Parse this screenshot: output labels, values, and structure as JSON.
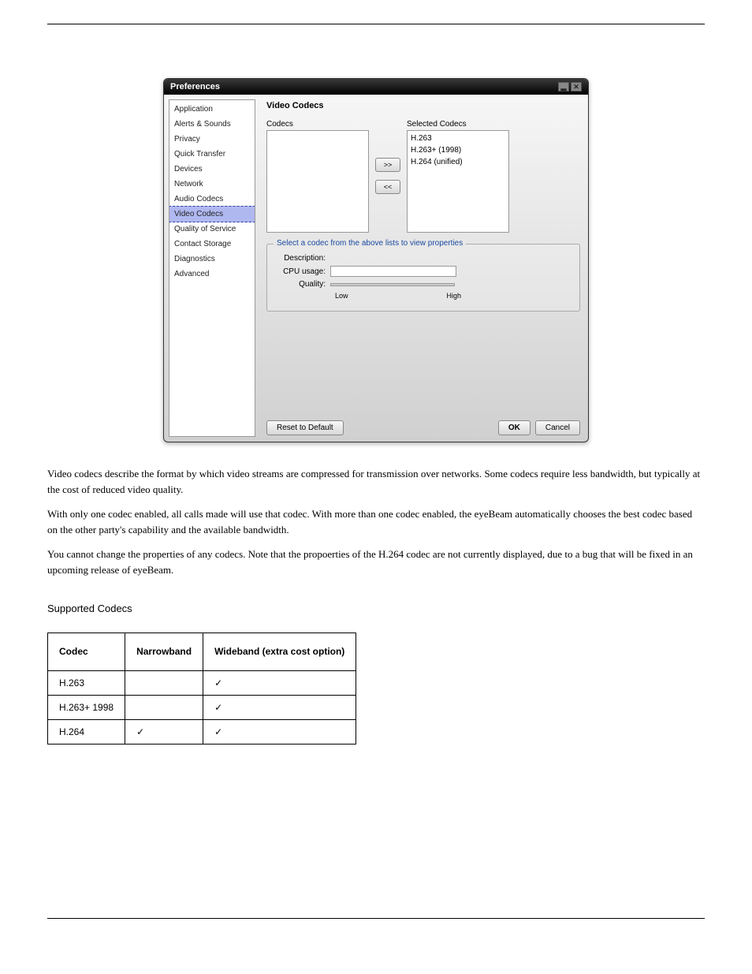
{
  "window": {
    "title": "Preferences",
    "minimize_glyph": "▂",
    "close_glyph": "✕"
  },
  "sidebar": {
    "items": [
      "Application",
      "Alerts & Sounds",
      "Privacy",
      "Quick Transfer",
      "Devices",
      "Network",
      "Audio Codecs",
      "Video Codecs",
      "Quality of Service",
      "Contact Storage",
      "Diagnostics",
      "Advanced"
    ],
    "selected_index": 7
  },
  "content": {
    "section_title": "Video Codecs",
    "codecs_label": "Codecs",
    "selected_codecs_label": "Selected Codecs",
    "selected_codecs": [
      "H.263",
      "H.263+ (1998)",
      "H.264 (unified)"
    ],
    "move_right": ">>",
    "move_left": "<<",
    "groupbox_legend": "Select a codec from the above lists to view properties",
    "description_label": "Description:",
    "cpu_usage_label": "CPU usage:",
    "quality_label": "Quality:",
    "slider_low": "Low",
    "slider_high": "High"
  },
  "buttons": {
    "reset": "Reset to Default",
    "ok": "OK",
    "cancel": "Cancel"
  },
  "body": {
    "p1": "Video codecs describe the format by which video streams are compressed for transmission over networks. Some codecs require less bandwidth, but typically at the cost of reduced video quality.",
    "p2": "With only one codec enabled, all calls made will use that codec. With more than one codec enabled, the eyeBeam automatically chooses the best codec based on the other party's capability and the available bandwidth.",
    "p3_prefix": "You cannot change the properties of any codecs. Note that the propoerties of the H.264 codec are not currently displayed, due to a bug that will be fixed in an ",
    "p3_middle": "upcoming release of ",
    "p3_suffix": "eyeBeam.",
    "supported": "Supported Codecs"
  },
  "table": {
    "h_codec": "Codec",
    "h_narrow": "Narrowband",
    "h_wide": "Wideband (extra cost option)",
    "rows": [
      {
        "codec": "H.263",
        "narrow": "",
        "wide": "✓"
      },
      {
        "codec": "H.263+ 1998",
        "narrow": "",
        "wide": "✓"
      },
      {
        "codec": "H.264",
        "narrow": "✓",
        "wide": "✓"
      }
    ]
  }
}
